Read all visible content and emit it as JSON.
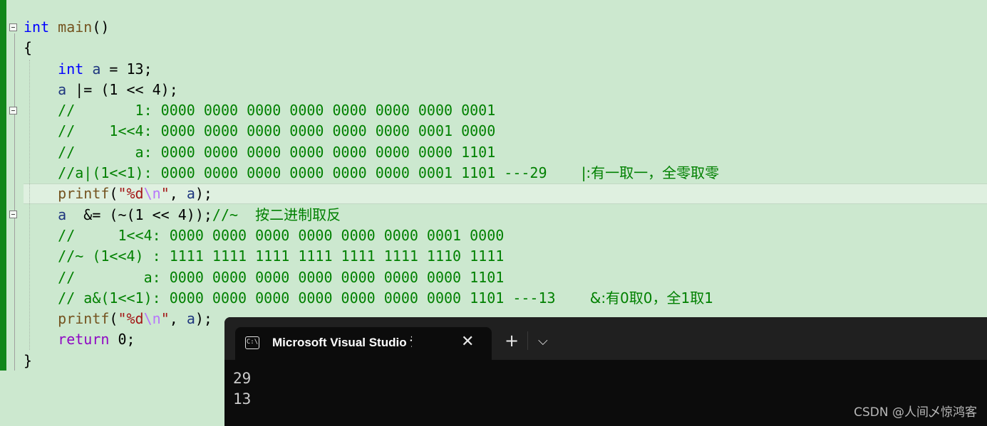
{
  "editor": {
    "lines": [
      [
        {
          "t": "int",
          "c": "kw"
        },
        {
          "t": " "
        },
        {
          "t": "main",
          "c": "fn"
        },
        {
          "t": "()"
        }
      ],
      [
        {
          "t": "{"
        }
      ],
      [
        {
          "t": "    "
        },
        {
          "t": "int",
          "c": "kw"
        },
        {
          "t": " "
        },
        {
          "t": "a",
          "c": "var"
        },
        {
          "t": " = 13;"
        }
      ],
      [
        {
          "t": "    "
        },
        {
          "t": "a",
          "c": "var"
        },
        {
          "t": " |= (1 << 4);"
        }
      ],
      [
        {
          "t": "    "
        },
        {
          "t": "//       1: 0000 0000 0000 0000 0000 0000 0000 0001",
          "c": "cm"
        }
      ],
      [
        {
          "t": "    "
        },
        {
          "t": "//    1<<4: 0000 0000 0000 0000 0000 0000 0001 0000",
          "c": "cm"
        }
      ],
      [
        {
          "t": "    "
        },
        {
          "t": "//       a: 0000 0000 0000 0000 0000 0000 0000 1101",
          "c": "cm"
        }
      ],
      [
        {
          "t": "    "
        },
        {
          "t": "//a|(1<<1): 0000 0000 0000 0000 0000 0000 0001 1101 ---29    ",
          "c": "cm"
        },
        {
          "t": "|:有一取一，全零取零",
          "c": "cmcn"
        }
      ],
      [
        {
          "t": "    "
        },
        {
          "t": "printf",
          "c": "fn"
        },
        {
          "t": "("
        },
        {
          "t": "\"%d",
          "c": "str"
        },
        {
          "t": "\\n",
          "c": "esc"
        },
        {
          "t": "\"",
          "c": "str"
        },
        {
          "t": ", "
        },
        {
          "t": "a",
          "c": "var"
        },
        {
          "t": ");"
        }
      ],
      [
        {
          "t": "    "
        },
        {
          "t": "a",
          "c": "var"
        },
        {
          "t": "  &= (~(1 << 4));"
        },
        {
          "t": "//~  ",
          "c": "cm"
        },
        {
          "t": "按二进制取反",
          "c": "cmcn"
        }
      ],
      [
        {
          "t": "    "
        },
        {
          "t": "//     1<<4: 0000 0000 0000 0000 0000 0000 0001 0000",
          "c": "cm"
        }
      ],
      [
        {
          "t": "    "
        },
        {
          "t": "//~ (1<<4) : 1111 1111 1111 1111 1111 1111 1110 1111",
          "c": "cm"
        }
      ],
      [
        {
          "t": "    "
        },
        {
          "t": "//        a: 0000 0000 0000 0000 0000 0000 0000 1101",
          "c": "cm"
        }
      ],
      [
        {
          "t": "    "
        },
        {
          "t": "// a&(1<<1): 0000 0000 0000 0000 0000 0000 0000 1101 ---13    ",
          "c": "cm"
        },
        {
          "t": "&:有0取0，全1取1",
          "c": "cmcn"
        }
      ],
      [
        {
          "t": "    "
        },
        {
          "t": "printf",
          "c": "fn"
        },
        {
          "t": "("
        },
        {
          "t": "\"%d",
          "c": "str"
        },
        {
          "t": "\\n",
          "c": "esc"
        },
        {
          "t": "\"",
          "c": "str"
        },
        {
          "t": ", "
        },
        {
          "t": "a",
          "c": "var"
        },
        {
          "t": ");"
        }
      ],
      [
        {
          "t": "    "
        },
        {
          "t": "return",
          "c": "kwp"
        },
        {
          "t": " 0;"
        }
      ],
      [
        {
          "t": "}"
        }
      ]
    ]
  },
  "terminal": {
    "tab_icon": "C:\\",
    "tab_title": "Microsoft Visual Studio 调试控制台",
    "tab_icon_name": "console-icon",
    "close_glyph": "✕",
    "new_tab_glyph": "+",
    "dropdown_glyph": "⌵",
    "output": [
      "29",
      "13"
    ]
  },
  "watermark": "CSDN @人间乄惊鸿客"
}
